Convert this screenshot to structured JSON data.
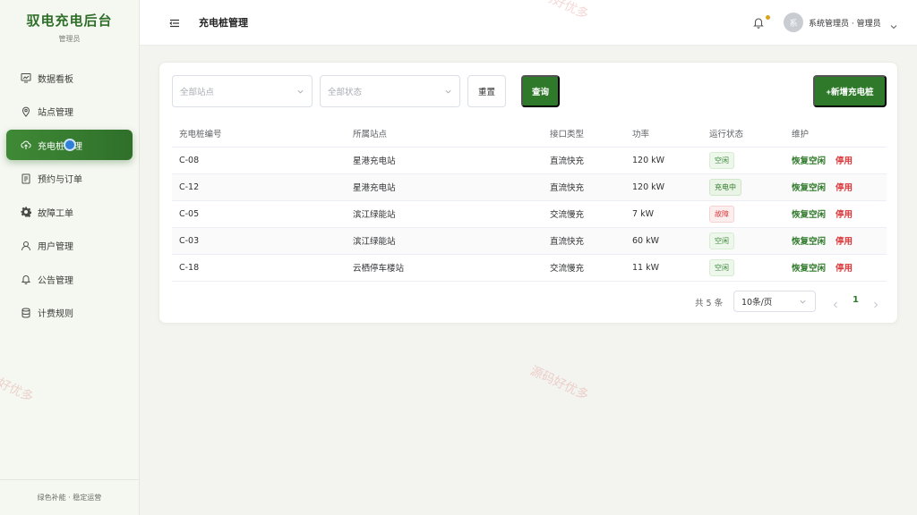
{
  "brand": {
    "title": "驭电充电后台",
    "role": "管理员"
  },
  "sidebar": {
    "items": [
      {
        "label": "数据看板",
        "icon": "chart-icon"
      },
      {
        "label": "站点管理",
        "icon": "location-icon"
      },
      {
        "label": "充电桩管理",
        "icon": "cloud-upload-icon"
      },
      {
        "label": "预约与订单",
        "icon": "document-icon"
      },
      {
        "label": "故障工单",
        "icon": "gear-icon"
      },
      {
        "label": "用户管理",
        "icon": "user-icon"
      },
      {
        "label": "公告管理",
        "icon": "bell-icon"
      },
      {
        "label": "计费规则",
        "icon": "database-icon"
      }
    ],
    "footer": "绿色补能 · 稳定运营"
  },
  "header": {
    "title": "充电桩管理",
    "avatar_text": "系",
    "user": "系统管理员 · 管理员"
  },
  "filters": {
    "station_placeholder": "全部站点",
    "status_placeholder": "全部状态",
    "reset_label": "重置",
    "query_label": "查询",
    "add_label": "+新增充电桩"
  },
  "table": {
    "headers": [
      "充电桩编号",
      "所属站点",
      "接口类型",
      "功率",
      "运行状态",
      "维护"
    ],
    "rows": [
      {
        "id": "C-08",
        "station": "星港充电站",
        "type": "直流快充",
        "power": "120 kW",
        "status": "空闲"
      },
      {
        "id": "C-12",
        "station": "星港充电站",
        "type": "直流快充",
        "power": "120 kW",
        "status": "充电中"
      },
      {
        "id": "C-05",
        "station": "滨江绿能站",
        "type": "交流慢充",
        "power": "7 kW",
        "status": "故障"
      },
      {
        "id": "C-03",
        "station": "滨江绿能站",
        "type": "直流快充",
        "power": "60 kW",
        "status": "空闲"
      },
      {
        "id": "C-18",
        "station": "云栖停车楼站",
        "type": "交流慢充",
        "power": "11 kW",
        "status": "空闲"
      }
    ],
    "action_restore": "恢复空闲",
    "action_disable": "停用"
  },
  "pagination": {
    "total": "共 5 条",
    "page_size": "10条/页",
    "current": "1"
  },
  "watermark": "源码好优多",
  "colors": {
    "primary": "#2f7a2a",
    "danger": "#d9383b",
    "accent": "#d8a419"
  }
}
